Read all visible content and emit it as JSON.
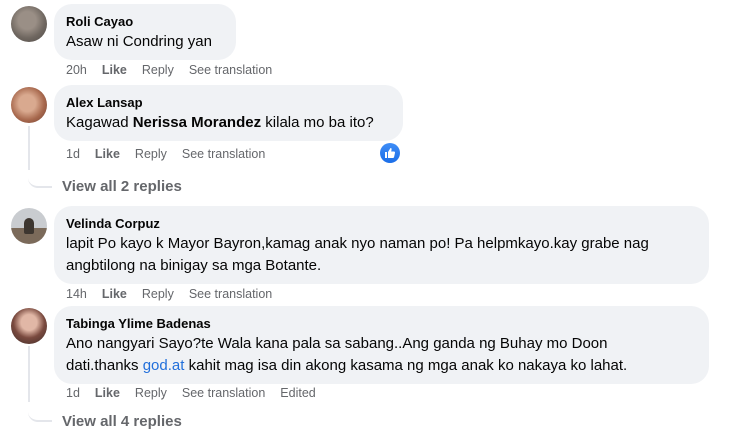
{
  "comments": [
    {
      "author": "Roli Cayao",
      "text": "Asaw ni Condring yan",
      "time": "20h",
      "like": "Like",
      "reply": "Reply",
      "translate": "See translation"
    },
    {
      "author": "Alex Lansap",
      "text_before": "Kagawad ",
      "mention": "Nerissa Morandez",
      "text_after": " kilala mo ba ito?",
      "time": "1d",
      "like": "Like",
      "reply": "Reply",
      "translate": "See translation",
      "reaction_icon": "thumbs-up-icon",
      "view_replies": "View all 2 replies"
    },
    {
      "author": "Velinda Corpuz",
      "text_line1": "lapit Po kayo k Mayor Bayron,kamag anak nyo naman po! Pa helpmkayo.kay grabe nag",
      "text_line2": "angbtilong na binigay sa mga Botante.",
      "time": "14h",
      "like": "Like",
      "reply": "Reply",
      "translate": "See translation"
    },
    {
      "author": "Tabinga Ylime Badenas",
      "text_line1": "Ano nangyari Sayo?te Wala kana pala sa sabang..Ang ganda ng Buhay mo Doon",
      "text_line2_before": "dati.thanks ",
      "text_line2_link": "god.at",
      "text_line2_after": " kahit mag isa din akong kasama ng mga anak ko nakaya ko lahat.",
      "time": "1d",
      "like": "Like",
      "reply": "Reply",
      "translate": "See translation",
      "edited": "Edited",
      "view_replies": "View all 4 replies"
    }
  ],
  "colors": {
    "bubble": "#f0f2f5",
    "meta_text": "#65676b",
    "link": "#216fdb",
    "like_badge": "#1b6ee8"
  }
}
